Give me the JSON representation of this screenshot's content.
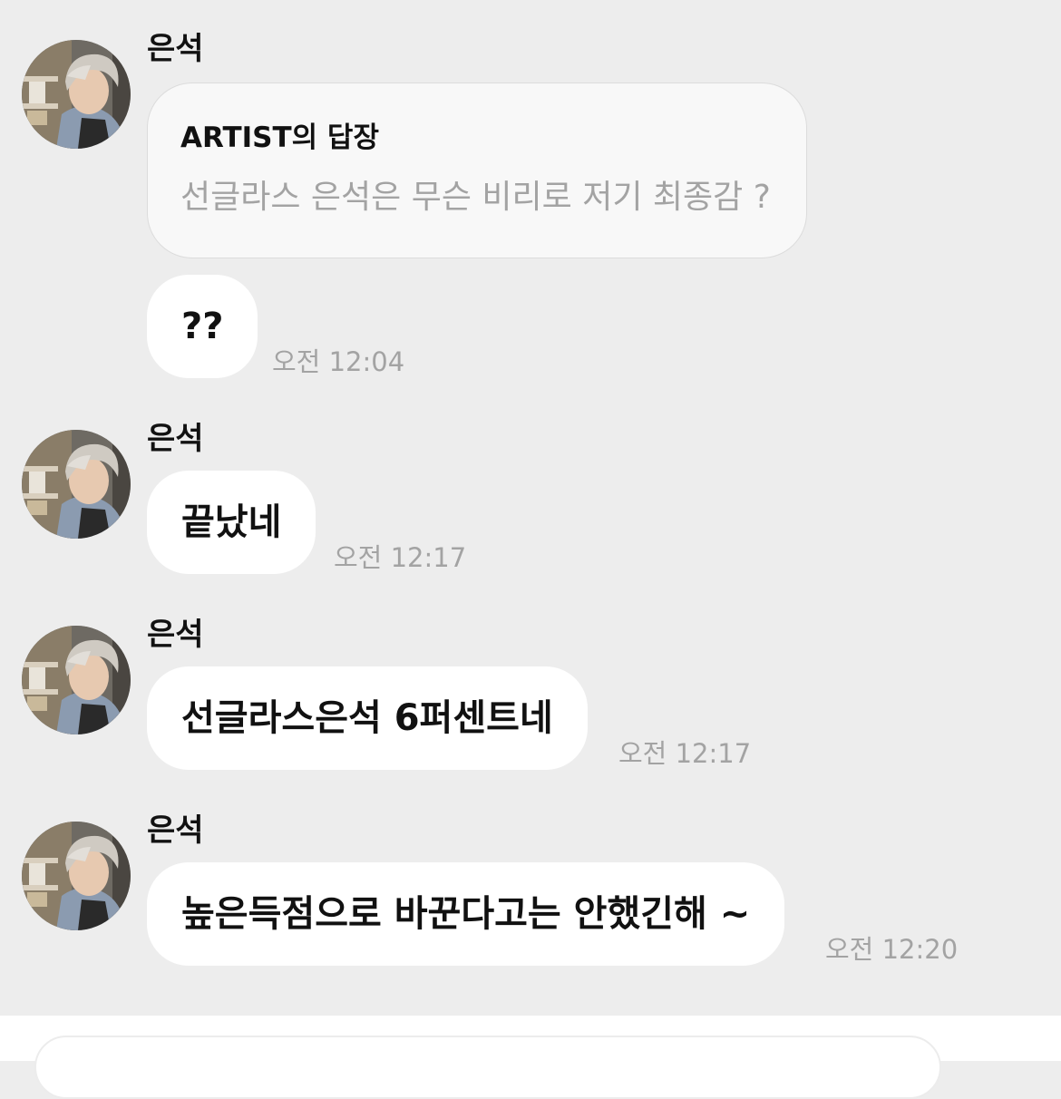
{
  "messages": [
    {
      "sender": "은석",
      "reply_label": "ARTIST의 답장",
      "reply_quote": "선글라스 은석은 무슨 비리로 저기 최종감 ?",
      "text": "??",
      "time": "오전 12:04"
    },
    {
      "sender": "은석",
      "text": "끝났네",
      "time": "오전 12:17"
    },
    {
      "sender": "은석",
      "text": "선글라스은석 6퍼센트네",
      "time": "오전 12:17"
    },
    {
      "sender": "은석",
      "text": "높은득점으로 바꾼다고는 안했긴해 ~",
      "time": "오전 12:20"
    }
  ],
  "avatar": {
    "icon": "profile-photo",
    "colors": {
      "hair": "#cfcac2",
      "shirt": "#8b9bb0",
      "apron": "#2a2a2a",
      "bg": "#6e6a63"
    }
  },
  "colors": {
    "background": "#ededed",
    "bubble": "#ffffff",
    "time": "#a3a3a3"
  }
}
